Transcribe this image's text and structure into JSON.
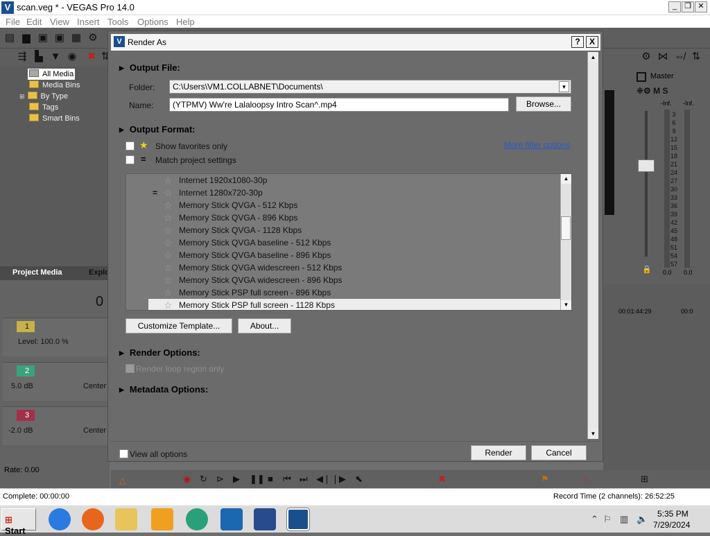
{
  "app": {
    "title": "scan.veg * - VEGAS Pro 14.0",
    "menu": [
      "File",
      "Edit",
      "View",
      "Insert",
      "Tools",
      "Options",
      "Help"
    ]
  },
  "media_tree": {
    "items": [
      "All Media",
      "Media Bins",
      "By Type",
      "Tags",
      "Smart Bins"
    ],
    "tabs": [
      "Project Media",
      "Explo"
    ]
  },
  "tracks": [
    {
      "number": "1",
      "level": "Level: 100.0 %",
      "color": "#c6b24a"
    },
    {
      "number": "2",
      "level": "5.0 dB",
      "pan": "Center",
      "color": "#3aa37e"
    },
    {
      "number": "3",
      "level": "-2.0 dB",
      "pan": "Center",
      "color": "#a3304a"
    }
  ],
  "rate": "Rate: 0.00",
  "time_fragment": "0",
  "mixer": {
    "master_label": "Master",
    "peak_left": "-Inf.",
    "peak_right": "-Inf.",
    "scale": [
      "3",
      "6",
      "9",
      "12",
      "15",
      "18",
      "21",
      "24",
      "27",
      "30",
      "33",
      "36",
      "39",
      "42",
      "45",
      "48",
      "51",
      "54",
      "57"
    ],
    "bottom_left": "0.0",
    "bottom_right": "0.0"
  },
  "timeline": {
    "tc1": "00:01:44:29",
    "tc2": "00:0"
  },
  "status": {
    "left": "Complete: 00:00:00",
    "right": "Record Time (2 channels): 26:52:25"
  },
  "taskbar": {
    "start": "Start",
    "time": "5:35 PM",
    "date": "7/29/2024"
  },
  "dialog": {
    "title": "Render As",
    "help_btn": "?",
    "close_btn": "X",
    "output_file": {
      "heading": "Output File:",
      "folder_label": "Folder:",
      "folder_value": "C:\\Users\\VM1.COLLABNET\\Documents\\",
      "name_label": "Name:",
      "name_value": "(YTPMV) Ww're Lalaloopsy Intro Scan^.mp4",
      "browse": "Browse..."
    },
    "output_format": {
      "heading": "Output Format:",
      "show_favorites": "Show favorites only",
      "match_settings": "Match project settings",
      "filter_link": "More filter options",
      "templates": [
        "Internet 1920x1080-30p",
        "Internet 1280x720-30p",
        "Memory Stick QVGA - 512 Kbps",
        "Memory Stick QVGA - 896 Kbps",
        "Memory Stick QVGA - 1128 Kbps",
        "Memory Stick QVGA baseline - 512 Kbps",
        "Memory Stick QVGA baseline - 896 Kbps",
        "Memory Stick QVGA widescreen - 512 Kbps",
        "Memory Stick QVGA widescreen - 896 Kbps",
        "Memory Stick PSP full screen - 896 Kbps",
        "Memory Stick PSP full screen - 1128 Kbps"
      ],
      "selected_template": "Memory Stick PSP full screen - 1128 Kbps",
      "customize": "Customize Template...",
      "about": "About..."
    },
    "render_options": {
      "heading": "Render Options:",
      "loop_region": "Render loop region only"
    },
    "metadata": {
      "heading": "Metadata Options:"
    },
    "view_all": "View all options",
    "render": "Render",
    "cancel": "Cancel"
  }
}
